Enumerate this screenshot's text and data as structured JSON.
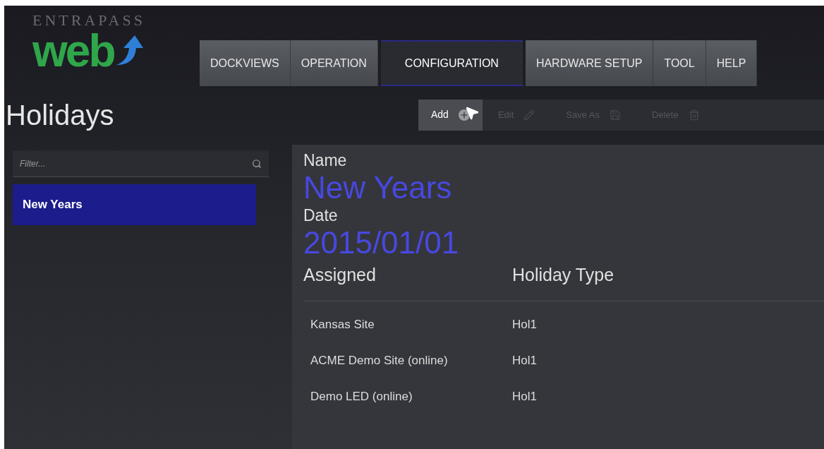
{
  "logo": {
    "top": "ENTRAPASS",
    "word": "web"
  },
  "tabs": [
    {
      "label": "DOCKVIEWS",
      "selected": false
    },
    {
      "label": "OPERATION",
      "selected": false
    },
    {
      "label": "CONFIGURATION",
      "selected": true
    },
    {
      "label": "HARDWARE SETUP",
      "selected": false
    },
    {
      "label": "TOOL",
      "selected": false
    },
    {
      "label": "HELP",
      "selected": false
    }
  ],
  "page_title": "Holidays",
  "toolbar": [
    {
      "label": "Add",
      "kind": "add",
      "disabled": false
    },
    {
      "label": "Edit",
      "kind": "edit",
      "disabled": true
    },
    {
      "label": "Save As",
      "kind": "save",
      "disabled": true
    },
    {
      "label": "Delete",
      "kind": "delete",
      "disabled": true
    }
  ],
  "filter": {
    "placeholder": "Filter..."
  },
  "sidebar": {
    "items": [
      {
        "label": "New Years",
        "selected": true
      }
    ]
  },
  "fields": [
    {
      "label": "Name",
      "value": "New Years"
    },
    {
      "label": "Date",
      "value": "2015/01/01"
    }
  ],
  "table": {
    "columns": [
      "Assigned",
      "Holiday Type"
    ],
    "rows": [
      [
        "Kansas Site",
        "Hol1"
      ],
      [
        "ACME Demo Site (online)",
        "Hol1"
      ],
      [
        "Demo LED (online)",
        "Hol1"
      ]
    ]
  }
}
